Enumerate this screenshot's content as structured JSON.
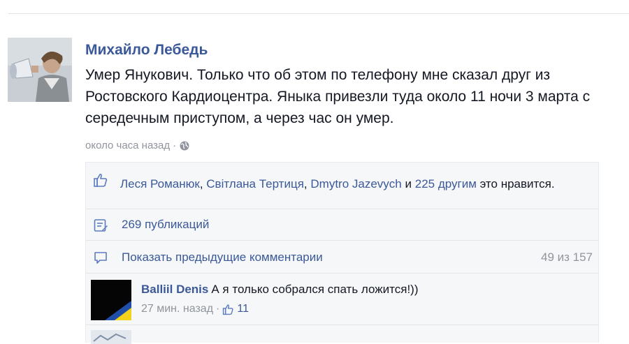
{
  "post": {
    "author": "Михайло Лебедь",
    "text": "Умер Янукович. Только что об этом по телефону мне сказал друг из Ростовского Кардиоцентра. Яныка привезли туда около 11 ночи 3 марта с середечным приступом, а через час он умер.",
    "timestamp": "около часа назад",
    "separator": "·",
    "audience_icon": "globe-icon"
  },
  "likes": {
    "icon": "thumbs-up-icon",
    "names": [
      "Леся Романюк",
      "Світлана Тертиця",
      "Dmytro Jazevych"
    ],
    "comma": ",",
    "and": "и",
    "others": "225 другим",
    "suffix": "это нравится."
  },
  "shares": {
    "icon": "share-icon",
    "label": "269 публикаций"
  },
  "comments_header": {
    "icon": "comment-icon",
    "label": "Показать предыдущие комментарии",
    "count": "49 из 157"
  },
  "comments": [
    {
      "author": "Balliil Denis",
      "text": "А я только собрался спать ложится!))",
      "time": "27 мин. назад",
      "separator": "·",
      "likes": "11"
    }
  ],
  "colors": {
    "link": "#3b5998",
    "meta": "#90949c",
    "ufi_bg": "#f6f7f9"
  }
}
